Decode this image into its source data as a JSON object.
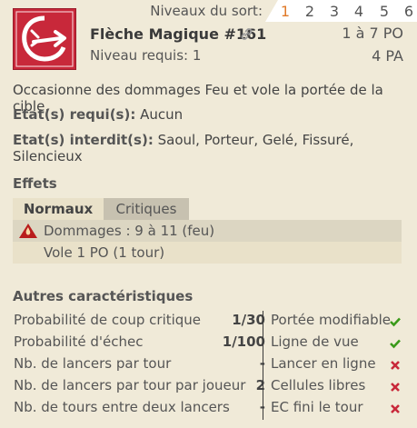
{
  "header": {
    "levels_label": "Niveaux du sort:",
    "levels": [
      "1",
      "2",
      "3",
      "4",
      "5",
      "6"
    ],
    "active_level": "1",
    "spell_name": "Flèche Magique #161",
    "required_level": "Niveau requis: 1",
    "range": "1 à 7 PO",
    "ap_cost": "4 PA"
  },
  "description": "Occasionne des dommages Feu et vole la portée de la cible.",
  "states": {
    "required_label": "Etat(s) requi(s):",
    "required_value": "Aucun",
    "forbidden_label": "Etat(s) interdit(s):",
    "forbidden_value": "Saoul, Porteur, Gelé, Fissuré, Silencieux"
  },
  "effects": {
    "title": "Effets",
    "tabs": [
      "Normaux",
      "Critiques"
    ],
    "rows": [
      {
        "text": "Dommages : 9 à 11 (feu)",
        "icon": "fire-damage-icon"
      },
      {
        "text": "Vole 1 PO (1 tour)",
        "icon": ""
      }
    ]
  },
  "characteristics": {
    "title": "Autres caractéristiques",
    "rows": [
      {
        "label": "Probabilité de coup critique",
        "value": "1/30",
        "flag_label": "Portée modifiable",
        "flag": true
      },
      {
        "label": "Probabilité d'échec",
        "value": "1/100",
        "flag_label": "Ligne de vue",
        "flag": true
      },
      {
        "label": "Nb. de lancers par tour",
        "value": "-",
        "flag_label": "Lancer en ligne",
        "flag": false
      },
      {
        "label": "Nb. de lancers par tour par joueur",
        "value": "2",
        "flag_label": "Cellules libres",
        "flag": false
      },
      {
        "label": "Nb. de tours entre deux lancers",
        "value": "-",
        "flag_label": "EC fini le tour",
        "flag": false
      }
    ]
  },
  "colors": {
    "background": "#f0ead8",
    "accent_active_level": "#e07a2a",
    "check": "#3a9a1a",
    "cross": "#c8283a",
    "spell_icon_bg": "#c8283a"
  }
}
